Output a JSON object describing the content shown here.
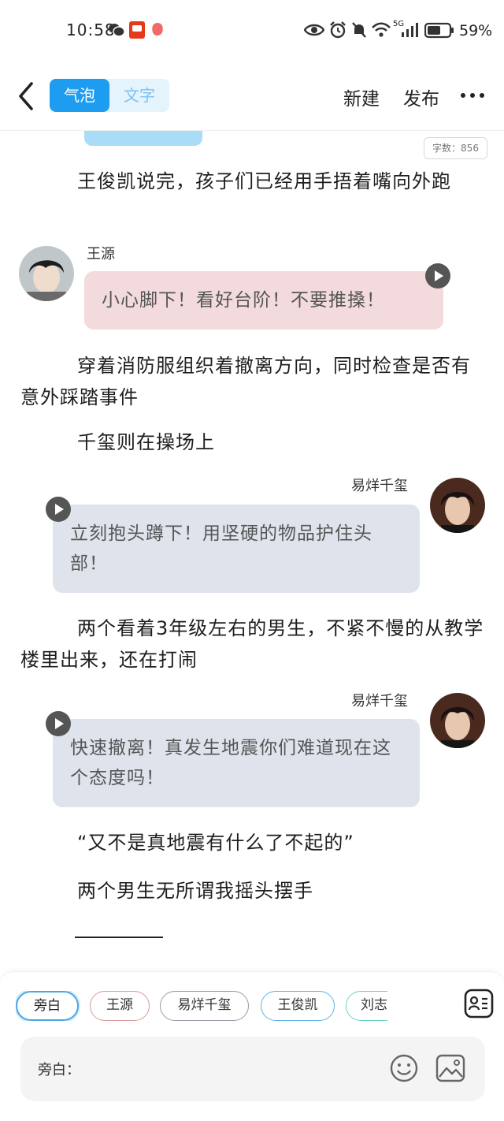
{
  "status_bar": {
    "time": "10:58",
    "signal": "5G",
    "battery": "59%"
  },
  "header": {
    "mode_tabs": [
      "气泡",
      "文字"
    ],
    "new_label": "新建",
    "publish_label": "发布"
  },
  "word_count": "字数：856",
  "story": [
    {
      "type": "narration",
      "text": "王俊凯说完，孩子们已经用手捂着嘴向外跑"
    },
    {
      "type": "bubble",
      "speaker": "王源",
      "text": "小心脚下！看好台阶！不要推搡！"
    },
    {
      "type": "narration",
      "text": "穿着消防服组织着撤离方向，同时检查是否有意外踩踏事件"
    },
    {
      "type": "narration",
      "text": "千玺则在操场上"
    },
    {
      "type": "bubble",
      "speaker": "易烊千玺",
      "text": "立刻抱头蹲下！用坚硬的物品护住头部！"
    },
    {
      "type": "narration",
      "text": "两个看着3年级左右的男生，不紧不慢的从教学楼里出来，还在打闹"
    },
    {
      "type": "bubble",
      "speaker": "易烊千玺",
      "text": "快速撤离！真发生地震你们难道现在这个态度吗！"
    },
    {
      "type": "narration",
      "text": "“又不是真地震有什么了不起的”"
    },
    {
      "type": "narration",
      "text": "两个男生无所谓我摇头摆手"
    }
  ],
  "role_chips": [
    "旁白",
    "王源",
    "易烊千玺",
    "王俊凯",
    "刘志"
  ],
  "input": {
    "label": "旁白：",
    "value": "",
    "placeholder": ""
  },
  "colors": {
    "accent": "#1e9cf0",
    "pink_bubble": "#f2dadd",
    "gray_bubble": "#dfe4ec"
  },
  "icons": [
    "back-icon",
    "more-icon",
    "play-icon",
    "roles-icon",
    "emoji-icon",
    "image-icon"
  ]
}
